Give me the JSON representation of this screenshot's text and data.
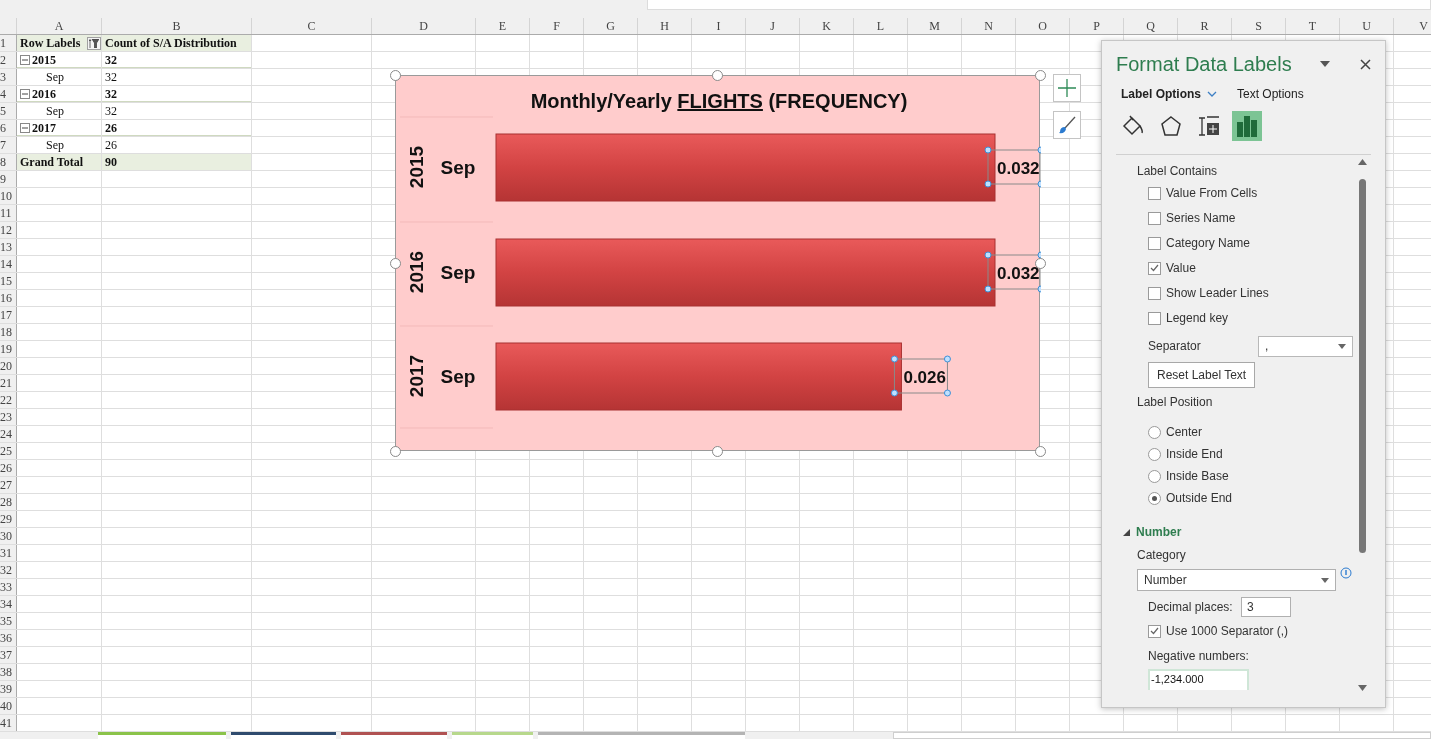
{
  "columns": [
    "A",
    "B",
    "C",
    "D",
    "E",
    "F",
    "G",
    "H",
    "I",
    "J",
    "K",
    "L",
    "M",
    "N",
    "O",
    "P",
    "Q",
    "R",
    "S",
    "T",
    "U",
    "V"
  ],
  "row_numbers": [
    "1",
    "2",
    "3",
    "4",
    "5",
    "6",
    "7",
    "8",
    "9",
    "10",
    "11",
    "12",
    "13",
    "14",
    "15",
    "16",
    "17",
    "18",
    "19",
    "20",
    "21",
    "22",
    "23",
    "24",
    "25",
    "26",
    "27",
    "28",
    "29",
    "30",
    "31",
    "32",
    "33",
    "34",
    "35",
    "36",
    "37",
    "38",
    "39",
    "40",
    "41"
  ],
  "pivot": {
    "header": {
      "row_labels": "Row Labels",
      "value": "Count of S/A Distribution",
      "filtered": true
    },
    "groups": [
      {
        "label": "2015",
        "total": "32",
        "expanded": true,
        "children": [
          {
            "label": "Sep",
            "value": "32"
          }
        ]
      },
      {
        "label": "2016",
        "total": "32",
        "expanded": true,
        "children": [
          {
            "label": "Sep",
            "value": "32"
          }
        ]
      },
      {
        "label": "2017",
        "total": "26",
        "expanded": true,
        "children": [
          {
            "label": "Sep",
            "value": "26"
          }
        ]
      }
    ],
    "grand_total": {
      "label": "Grand Total",
      "value": "90"
    }
  },
  "chart": {
    "selected": true,
    "labels_selected": true,
    "title_segments": [
      {
        "text": "Monthly/Yearly ",
        "underline": false
      },
      {
        "text": "FLIGHTS",
        "underline": true
      },
      {
        "text": " (FREQUENCY)",
        "underline": false
      }
    ],
    "groups": [
      "2015",
      "2016",
      "2017"
    ],
    "chart_data": {
      "type": "bar",
      "orientation": "horizontal",
      "categories": [
        "Sep",
        "Sep",
        "Sep"
      ],
      "values": [
        0.032,
        0.032,
        0.026
      ],
      "data_labels": true,
      "value_labels": [
        "0.032",
        "0.032",
        "0.026"
      ]
    }
  },
  "panel": {
    "title": "Format Data Labels",
    "tabs": [
      {
        "label": "Label Options",
        "selected": true
      },
      {
        "label": "Text Options",
        "selected": false
      }
    ],
    "icons": [
      {
        "kind": "fill",
        "selected": false
      },
      {
        "kind": "effects",
        "selected": false
      },
      {
        "kind": "size",
        "selected": false
      },
      {
        "kind": "options",
        "selected": true
      }
    ],
    "label_contains": {
      "heading": "Label Contains",
      "options": [
        {
          "label": "Value From Cells",
          "checked": false
        },
        {
          "label": "Series Name",
          "checked": false
        },
        {
          "label": "Category Name",
          "checked": false
        },
        {
          "label": "Value",
          "checked": true
        },
        {
          "label": "Show Leader Lines",
          "checked": false
        },
        {
          "label": "Legend key",
          "checked": false
        }
      ]
    },
    "separator": {
      "label": "Separator",
      "value": ","
    },
    "reset_button": "Reset Label Text",
    "label_position": {
      "heading": "Label Position",
      "options": [
        {
          "label": "Center",
          "selected": false
        },
        {
          "label": "Inside End",
          "selected": false
        },
        {
          "label": "Inside Base",
          "selected": false
        },
        {
          "label": "Outside End",
          "selected": true
        }
      ]
    },
    "number": {
      "heading": "Number",
      "expanded": true,
      "category_label": "Category",
      "category_value": "Number",
      "decimal_label": "Decimal places:",
      "decimal_value": "3",
      "separator_option": {
        "label": "Use 1000 Separator (,)",
        "checked": true
      },
      "negative_label": "Negative numbers:",
      "negative_options": [
        {
          "label": "-1,234.000",
          "selected": true
        }
      ]
    }
  },
  "sheet_tabs": [
    {
      "color": "#8bc34a"
    },
    {
      "color": "#2f4b6e"
    },
    {
      "color": "#b05252"
    },
    {
      "color": "#b7d88c"
    },
    {
      "color": "#b4b4b4"
    }
  ]
}
